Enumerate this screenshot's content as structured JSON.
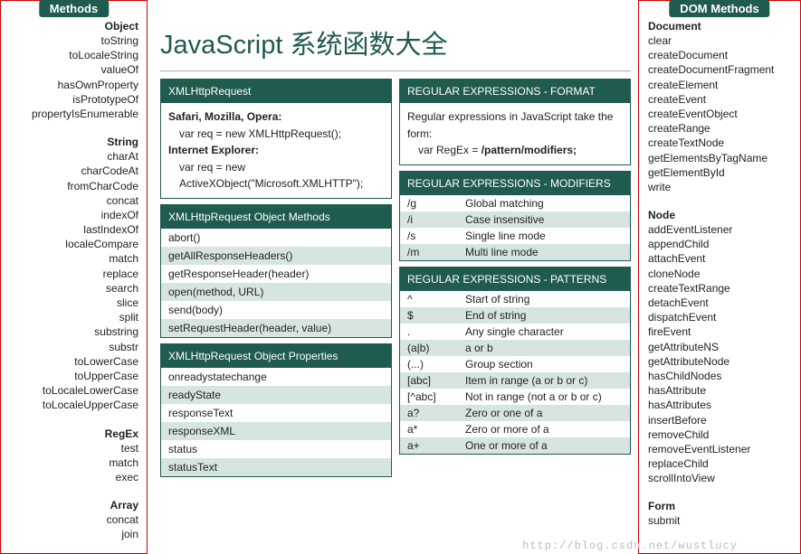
{
  "page_title": "JavaScript 系统函数大全",
  "watermark": "http://blog.csdn.net/wustlucy",
  "left_sidebar": {
    "title": "Methods",
    "groups": [
      {
        "name": "Object",
        "items": [
          "toString",
          "toLocaleString",
          "valueOf",
          "hasOwnProperty",
          "isPrototypeOf",
          "propertyIsEnumerable"
        ]
      },
      {
        "name": "String",
        "items": [
          "charAt",
          "charCodeAt",
          "fromCharCode",
          "concat",
          "indexOf",
          "lastIndexOf",
          "localeCompare",
          "match",
          "replace",
          "search",
          "slice",
          "split",
          "substring",
          "substr",
          "toLowerCase",
          "toUpperCase",
          "toLocaleLowerCase",
          "toLocaleUpperCase"
        ]
      },
      {
        "name": "RegEx",
        "items": [
          "test",
          "match",
          "exec"
        ]
      },
      {
        "name": "Array",
        "items": [
          "concat",
          "join"
        ]
      }
    ]
  },
  "right_sidebar": {
    "title": "DOM Methods",
    "groups": [
      {
        "name": "Document",
        "items": [
          "clear",
          "createDocument",
          "createDocumentFragment",
          "createElement",
          "createEvent",
          "createEventObject",
          "createRange",
          "createTextNode",
          "getElementsByTagName",
          "getElementById",
          "write"
        ]
      },
      {
        "name": "Node",
        "items": [
          "addEventListener",
          "appendChild",
          "attachEvent",
          "cloneNode",
          "createTextRange",
          "detachEvent",
          "dispatchEvent",
          "fireEvent",
          "getAttributeNS",
          "getAttributeNode",
          "hasChildNodes",
          "hasAttribute",
          "hasAttributes",
          "insertBefore",
          "removeChild",
          "removeEventListener",
          "replaceChild",
          "scrollIntoView"
        ]
      },
      {
        "name": "Form",
        "items": [
          "submit"
        ]
      }
    ]
  },
  "panels": {
    "xhr": {
      "header": "XMLHttpRequest",
      "lines": [
        {
          "text": "Safari, Mozilla, Opera:",
          "bold": true
        },
        {
          "text": "var req = new XMLHttpRequest();",
          "indent": true
        },
        {
          "text": "Internet Explorer:",
          "bold": true
        },
        {
          "text": "var req = new",
          "indent": true
        },
        {
          "text": "ActiveXObject(\"Microsoft.XMLHTTP\");",
          "indent": true
        }
      ]
    },
    "xhr_methods": {
      "header": "XMLHttpRequest Object Methods",
      "items": [
        "abort()",
        "getAllResponseHeaders()",
        "getResponseHeader(header)",
        "open(method, URL)",
        "send(body)",
        "setRequestHeader(header, value)"
      ]
    },
    "xhr_props": {
      "header": "XMLHttpRequest Object Properties",
      "items": [
        "onreadystatechange",
        "readyState",
        "responseText",
        "responseXML",
        "status",
        "statusText"
      ]
    },
    "regex_format": {
      "header": "REGULAR EXPRESSIONS - FORMAT",
      "line1": "Regular expressions in JavaScript take the form:",
      "line2_pre": "var RegEx = ",
      "line2_bold": "/pattern/modifiers;"
    },
    "regex_modifiers": {
      "header": "REGULAR EXPRESSIONS - MODIFIERS",
      "rows": [
        {
          "k": "/g",
          "v": "Global matching"
        },
        {
          "k": "/i",
          "v": "Case insensitive"
        },
        {
          "k": "/s",
          "v": "Single line mode"
        },
        {
          "k": "/m",
          "v": "Multi line mode"
        }
      ]
    },
    "regex_patterns": {
      "header": "REGULAR EXPRESSIONS - PATTERNS",
      "rows": [
        {
          "k": "^",
          "v": "Start of string"
        },
        {
          "k": "$",
          "v": "End of string"
        },
        {
          "k": ".",
          "v": "Any single character"
        },
        {
          "k": "(a|b)",
          "v": "a or b"
        },
        {
          "k": "(...)",
          "v": "Group section"
        },
        {
          "k": "[abc]",
          "v": "Item in range (a or b or c)"
        },
        {
          "k": "[^abc]",
          "v": "Not in range (not a or b or c)"
        },
        {
          "k": "a?",
          "v": "Zero or one of a"
        },
        {
          "k": "a*",
          "v": "Zero or more of a"
        },
        {
          "k": "a+",
          "v": "One or more of a"
        }
      ]
    }
  }
}
